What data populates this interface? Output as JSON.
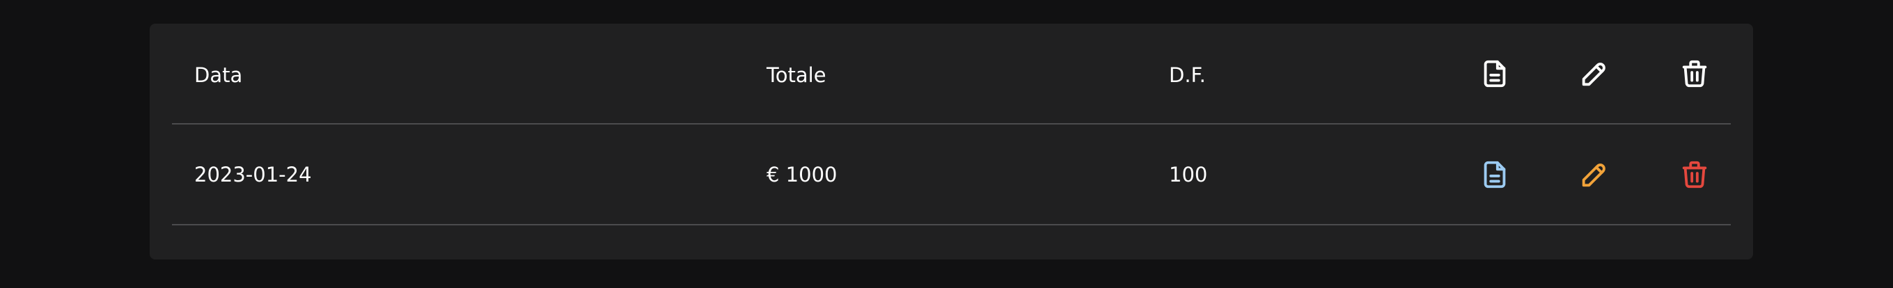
{
  "table": {
    "headers": {
      "data": "Data",
      "totale": "Totale",
      "df": "D.F."
    },
    "header_icons": [
      "document-icon",
      "pencil-icon",
      "trash-icon"
    ],
    "rows": [
      {
        "data": "2023-01-24",
        "totale": "€ 1000",
        "df": "100",
        "actions": [
          "view-document-icon",
          "edit-pencil-icon",
          "delete-trash-icon"
        ]
      }
    ]
  },
  "colors": {
    "background": "#111112",
    "card": "#202021",
    "divider": "#4c4c4e",
    "text": "#ffffff",
    "doc_accent": "#9ccbf2",
    "edit_accent": "#f2a33a",
    "delete_accent": "#e5483e"
  }
}
